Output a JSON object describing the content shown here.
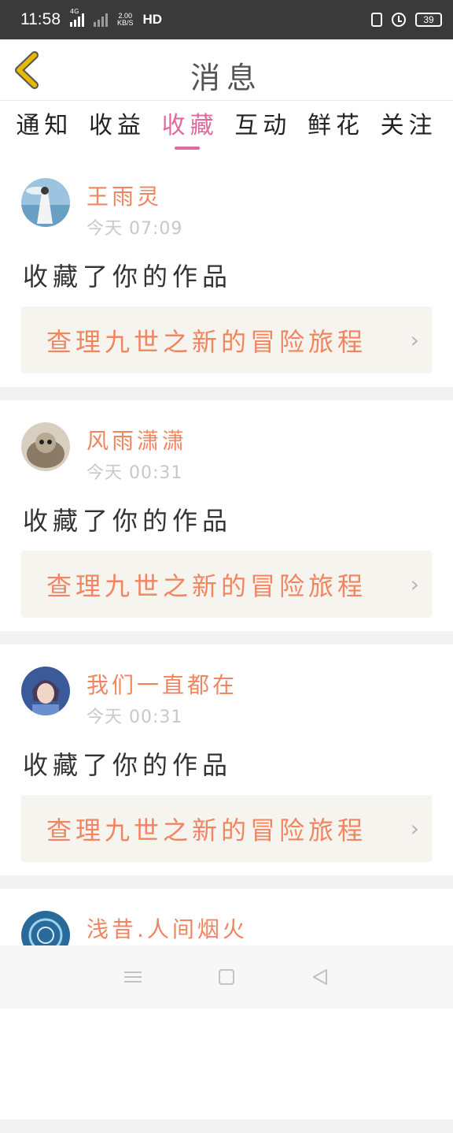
{
  "status_bar": {
    "time": "11:58",
    "net_4g": "4G",
    "speed_value": "2.00",
    "speed_unit": "KB/S",
    "hd": "HD",
    "battery": "39"
  },
  "header": {
    "title": "消息"
  },
  "tabs": [
    {
      "label": "通知"
    },
    {
      "label": "收益"
    },
    {
      "label": "收藏"
    },
    {
      "label": "互动"
    },
    {
      "label": "鲜花"
    },
    {
      "label": "关注"
    }
  ],
  "active_tab": "收藏",
  "feed": {
    "items": [
      {
        "user": "王雨灵",
        "time": "今天 07:09",
        "action": "收藏了你的作品",
        "work": "查理九世之新的冒险旅程"
      },
      {
        "user": "风雨潇潇",
        "time": "今天 00:31",
        "action": "收藏了你的作品",
        "work": "查理九世之新的冒险旅程"
      },
      {
        "user": "我们一直都在",
        "time": "今天 00:31",
        "action": "收藏了你的作品",
        "work": "查理九世之新的冒险旅程"
      },
      {
        "user": "浅昔.人间烟火"
      }
    ]
  },
  "colors": {
    "accent": "#e06aa0",
    "name": "#f08560",
    "back_icon": "#e8b800"
  },
  "icons": {
    "back": "chevron-left-icon",
    "menu": "menu-icon",
    "home": "home-icon",
    "nav_back": "nav-back-icon"
  }
}
